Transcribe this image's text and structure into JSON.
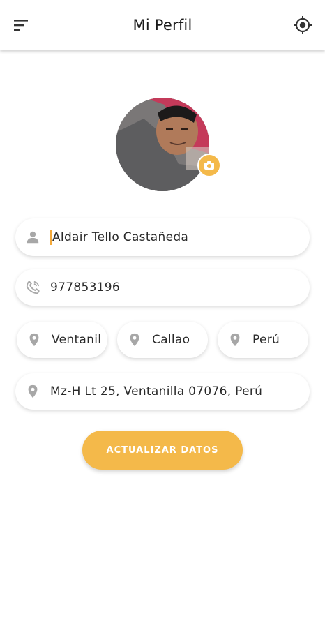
{
  "header": {
    "title": "Mi Perfil"
  },
  "form": {
    "name": "Aldair Tello Castañeda",
    "phone": "977853196",
    "district": "Ventanil",
    "province": "Callao",
    "country": "Perú",
    "address": "Mz-H Lt 25, Ventanilla 07076, Perú"
  },
  "actions": {
    "update_label": "ACTUALIZAR DATOS"
  },
  "icons": {
    "menu": "sort-menu-icon",
    "location": "gps-fixed-icon",
    "camera": "camera-icon",
    "person": "person-icon",
    "phone": "phone-icon",
    "pin": "location-pin-icon"
  },
  "colors": {
    "accent": "#f4b94a",
    "icon_gray": "#a7a7a7"
  }
}
